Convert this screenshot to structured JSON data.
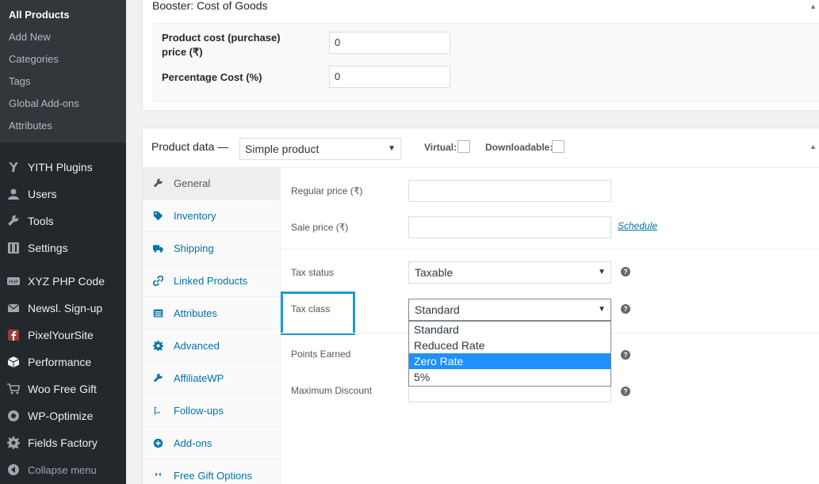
{
  "sidebar": {
    "submenu": [
      "All Products",
      "Add New",
      "Categories",
      "Tags",
      "Global Add-ons",
      "Attributes"
    ],
    "menu": [
      {
        "label": "YITH Plugins",
        "icon": "yith-icon"
      },
      {
        "label": "Users",
        "icon": "user-icon"
      },
      {
        "label": "Tools",
        "icon": "wrench-icon"
      },
      {
        "label": "Settings",
        "icon": "settings-icon"
      },
      {
        "label": "XYZ PHP Code",
        "icon": "php-icon"
      },
      {
        "label": "Newsl. Sign-up",
        "icon": "envelope-icon"
      },
      {
        "label": "PixelYourSite",
        "icon": "facebook-icon"
      },
      {
        "label": "Performance",
        "icon": "cube-icon"
      },
      {
        "label": "Woo Free Gift",
        "icon": "cart-icon"
      },
      {
        "label": "WP-Optimize",
        "icon": "optimize-icon"
      },
      {
        "label": "Fields Factory",
        "icon": "gear-icon"
      }
    ],
    "collapse": "Collapse menu"
  },
  "booster": {
    "title": "Booster: Cost of Goods",
    "product_cost_label": "Product cost (purchase) price (₹)",
    "product_cost_value": "0",
    "percentage_cost_label": "Percentage Cost (%)",
    "percentage_cost_value": "0"
  },
  "product_data": {
    "title": "Product data —",
    "type": "Simple product",
    "virtual_label": "Virtual:",
    "downloadable_label": "Downloadable:",
    "tabs": [
      "General",
      "Inventory",
      "Shipping",
      "Linked Products",
      "Attributes",
      "Advanced",
      "AffiliateWP",
      "Follow-ups",
      "Add-ons",
      "Free Gift Options"
    ],
    "fields": {
      "regular_price_label": "Regular price (₹)",
      "sale_price_label": "Sale price (₹)",
      "schedule_link": "Schedule",
      "tax_status_label": "Tax status",
      "tax_status_value": "Taxable",
      "tax_class_label": "Tax class",
      "tax_class_value": "Standard",
      "points_earned_label": "Points Earned",
      "max_discount_label": "Maximum Discount",
      "help": "?"
    },
    "tax_class_options": [
      "Standard",
      "Reduced Rate",
      "Zero Rate",
      "5%"
    ],
    "tax_class_highlighted": "Zero Rate"
  },
  "colors": {
    "accent": "#0073aa",
    "highlight_box": "#1e9ad6",
    "option_selected": "#1e90ff",
    "sidebar": "#23282d"
  }
}
